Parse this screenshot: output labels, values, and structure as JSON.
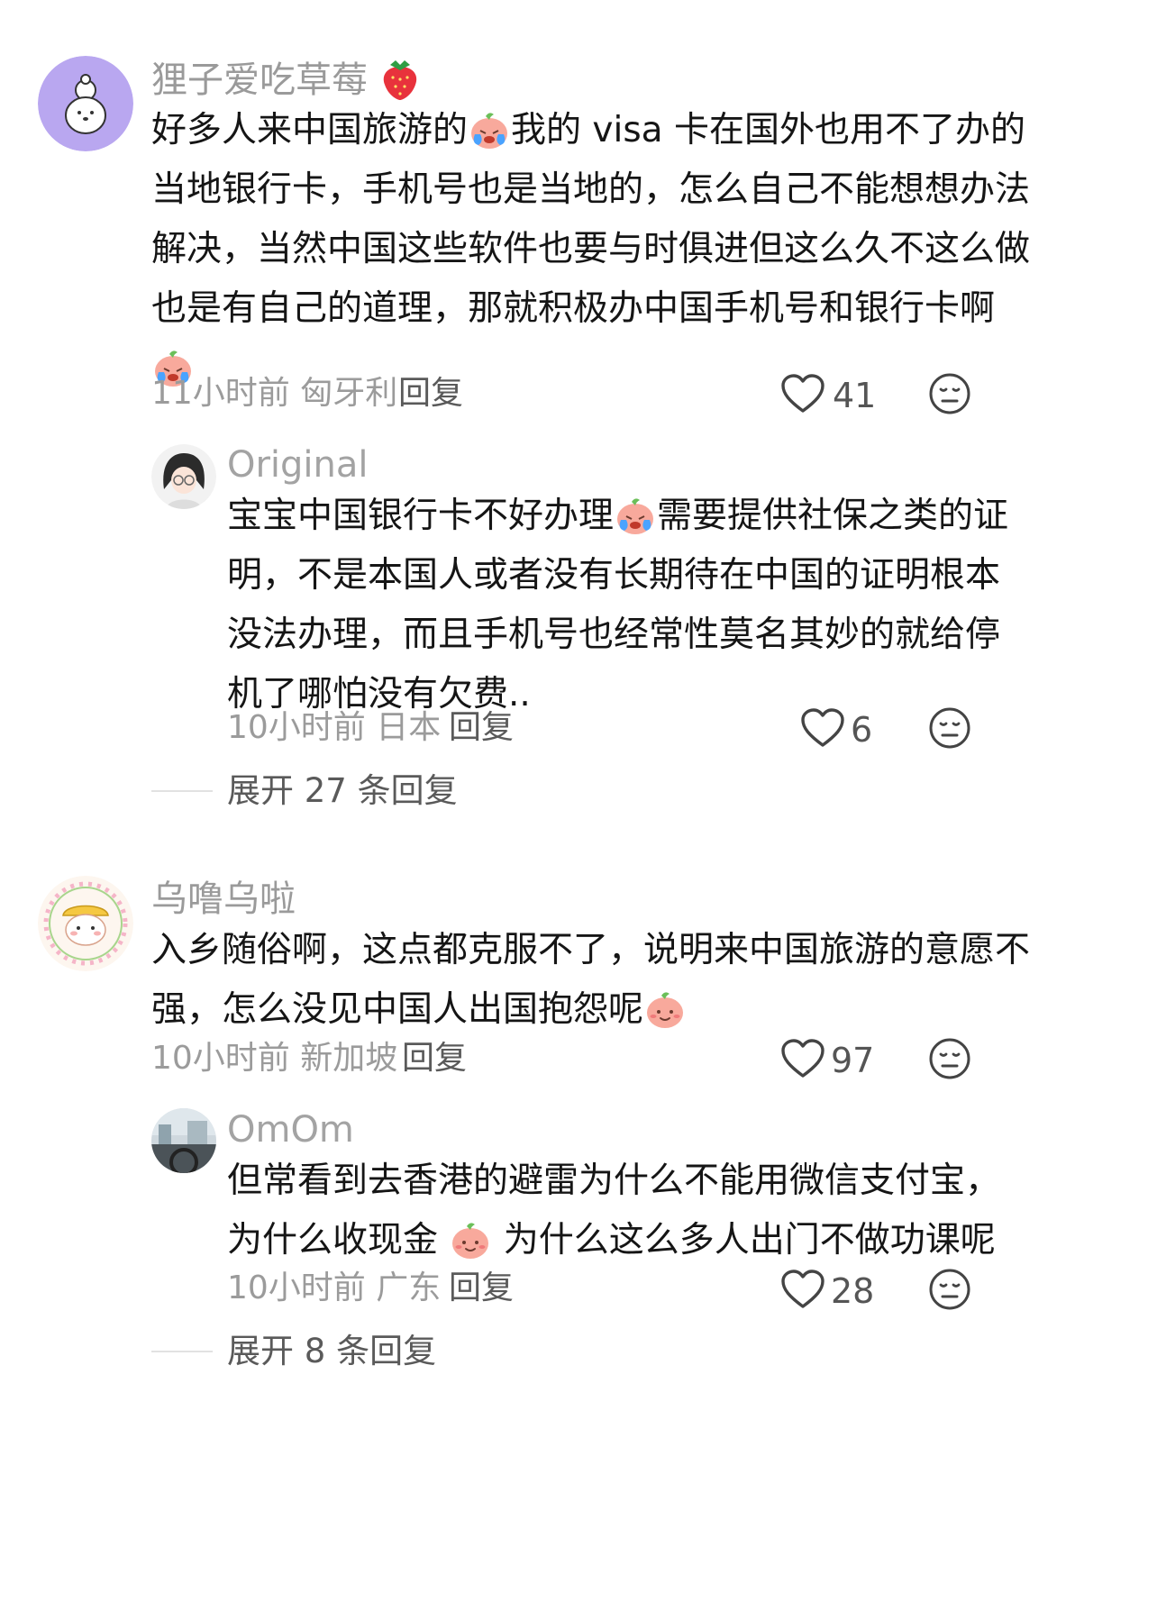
{
  "comments": [
    {
      "username": "狸子爱吃草莓",
      "body_lines": [
        [
          "好多人来中国旅游的",
          "我的 visa 卡在国外也用不了办的"
        ],
        [
          "当地银行卡，手机号也是当地的，怎么自己不能想想办法"
        ],
        [
          "解决，当然中国这些软件也要与时俱进但这么久不这么做"
        ],
        [
          "也是有自己的道理，那就积极办中国手机号和银行卡啊"
        ]
      ],
      "time": "11小时前",
      "location": "匈牙利",
      "reply_label": "回复",
      "likes": "41",
      "reply": {
        "username": "Original",
        "body_lines": [
          [
            "宝宝中国银行卡不好办理",
            "需要提供社保之类的证"
          ],
          [
            "明，不是本国人或者没有长期待在中国的证明根本"
          ],
          [
            "没法办理，而且手机号也经常性莫名其妙的就给停"
          ],
          [
            "机了哪怕没有欠费.."
          ]
        ],
        "time": "10小时前",
        "location": "日本",
        "reply_label": "回复",
        "likes": "6"
      },
      "expand_label": "展开 27 条回复"
    },
    {
      "username": "乌噜乌啦",
      "body_lines": [
        [
          "入乡随俗啊，这点都克服不了，说明来中国旅游的意愿不"
        ],
        [
          "强，怎么没见中国人出国抱怨呢"
        ]
      ],
      "time": "10小时前",
      "location": "新加坡",
      "reply_label": "回复",
      "likes": "97",
      "reply": {
        "username": "OmOm",
        "body_lines": [
          [
            "但常看到去香港的避雷为什么不能用微信支付宝，"
          ],
          [
            "为什么收现金 ",
            " 为什么这么多人出门不做功课呢"
          ]
        ],
        "time": "10小时前",
        "location": "广东",
        "reply_label": "回复",
        "likes": "28"
      },
      "expand_label": "展开 8 条回复"
    }
  ],
  "icons": {
    "like": "heart-outline-icon",
    "dislike": "neutral-face-icon",
    "emoji_cry": "crying-peach-emoji",
    "emoji_smile": "smiling-peach-emoji",
    "strawberry": "strawberry-emoji"
  },
  "colors": {
    "username": "#9a9a9a",
    "text": "#151515",
    "meta": "#9b9b9b"
  }
}
